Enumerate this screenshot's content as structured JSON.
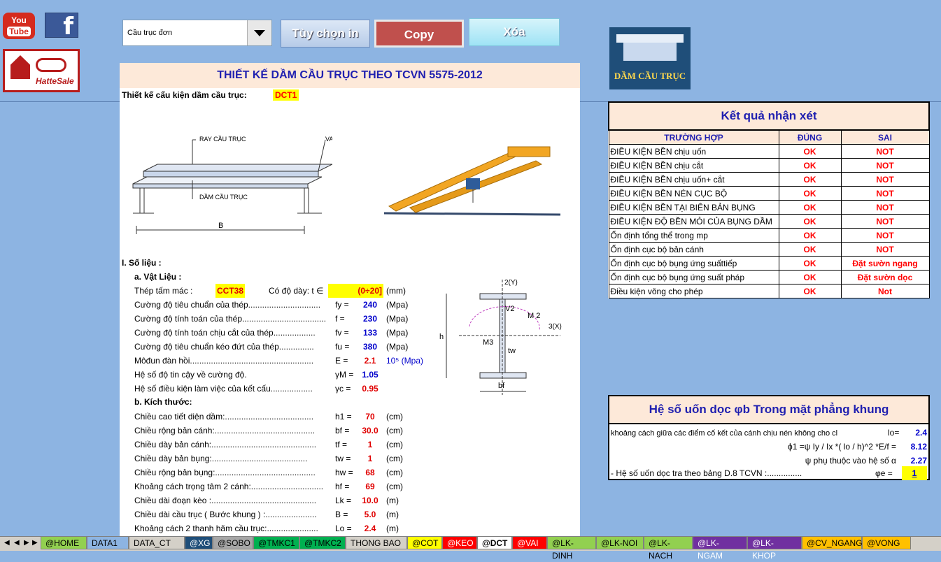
{
  "social": {
    "youtube_you": "You",
    "youtube_tube": "Tube",
    "facebook": "f",
    "hattesale": "HatteSale"
  },
  "toolbar": {
    "combo_value": "Cầu trục đơn",
    "btn_options": "Tùy chọn in",
    "btn_copy": "Copy",
    "btn_delete": "Xóa"
  },
  "logo_text": "DẦM CẦU TRỤC",
  "sheet": {
    "title": "THIẾT KẾ DẦM CẦU TRỤC THEO TCVN 5575-2012",
    "subtitle": "Thiết kế cấu kiện dầm cầu trục:",
    "code": "DCT1",
    "fig_labels": {
      "ray": "RAY CẦU TRỤC",
      "vai": "VAI CẦU TRỤC",
      "dam": "DẦM CẦU TRỤC",
      "b": "B"
    },
    "sec_title": "I.  Số liệu :",
    "mat_title": "a. Vật Liệu :",
    "steel_label": "Thép tấm mác :",
    "steel_value": "CCT38",
    "thick_label": "Có độ dày:  t ∈",
    "thick_value": "(0÷20]",
    "thick_unit": "(mm)",
    "section_labels": {
      "y": "2(Y)",
      "x": "3(X)",
      "v2": "V2",
      "m2": "M 2",
      "m3": "M3",
      "h": "h",
      "tw": "tw",
      "bf": "bf"
    },
    "materials": [
      {
        "label": "Cường độ tiêu chuẩn của thép...............................",
        "sym": "fy =",
        "value": "240",
        "unit": "(Mpa)"
      },
      {
        "label": "Cường độ tính toán của thép....................................",
        "sym": "f  =",
        "value": "230",
        "unit": "(Mpa)"
      },
      {
        "label": "Cường độ tính toán chịu cắt của thép..................",
        "sym": "fv =",
        "value": "133",
        "unit": "(Mpa)"
      },
      {
        "label": "Cường độ tiêu chuẩn kéo đứt của thép...............",
        "sym": "fu =",
        "value": "380",
        "unit": "(Mpa)"
      },
      {
        "label": "Môđun đàn hồi.....................................................",
        "sym": "E =",
        "value": "2.1",
        "unit": "10⁵ (Mpa)"
      },
      {
        "label": "Hệ số độ tin cậy về cường độ.",
        "sym": "γM =",
        "value": "1.05",
        "unit": ""
      },
      {
        "label": "Hệ số điều kiện làm việc của kết cấu..................",
        "sym": "γc =",
        "value": "0.95",
        "unit": ""
      }
    ],
    "dim_title": "b. Kích thước:",
    "dims": [
      {
        "label": "Chiều cao tiết diện dầm:......................................",
        "sym": "h1 =",
        "value": "70",
        "unit": "(cm)"
      },
      {
        "label": "Chiều rộng bản cánh:...........................................",
        "sym": "bf =",
        "value": "30.0",
        "unit": "(cm)"
      },
      {
        "label": "Chiều dày bản cánh:.............................................",
        "sym": "tf =",
        "value": "1",
        "unit": "(cm)"
      },
      {
        "label": "Chiều dày bản bụng:.........................................",
        "sym": "tw =",
        "value": "1",
        "unit": "(cm)"
      },
      {
        "label": "Chiều rộng bản bụng:...........................................",
        "sym": "hw =",
        "value": "68",
        "unit": "(cm)"
      },
      {
        "label": "Khoảng cách trọng tâm 2 cánh:...............................",
        "sym": "hf =",
        "value": "69",
        "unit": "(cm)"
      },
      {
        "label": "Chiều dài đoạn kèo :.............................................",
        "sym": "Lk =",
        "value": "10.0",
        "unit": "(m)"
      },
      {
        "label": "Chiều dài cầu trục ( Bước khung ) :......................",
        "sym": "B =",
        "value": "5.0",
        "unit": "(m)"
      },
      {
        "label": "Khoảng cách 2 thanh hãm cầu trục:......................",
        "sym": "Lo =",
        "value": "2.4",
        "unit": "(m)"
      }
    ]
  },
  "results": {
    "title": "Kết quả nhận xét",
    "headers": [
      "TRƯỜNG HỢP",
      "ĐÚNG",
      "SAI"
    ],
    "rows": [
      [
        "ĐIỀU KIỆN BỀN chịu uốn",
        "OK",
        "NOT"
      ],
      [
        "ĐIỀU KIỆN BỀN chịu cắt",
        "OK",
        "NOT"
      ],
      [
        "ĐIỀU KIỆN BỀN chịu uốn+ cắt",
        "OK",
        "NOT"
      ],
      [
        "ĐIỀU KIỆN BỀN NÉN CỤC BỘ",
        "OK",
        "NOT"
      ],
      [
        "ĐIỀU KIỆN BỀN TẠI BIÊN BẢN BỤNG",
        "OK",
        "NOT"
      ],
      [
        "ĐIỀU KIỆN ĐỘ BỀN MỎI CỦA BỤNG DẦM",
        "OK",
        "NOT"
      ],
      [
        "Ổn định tổng thể trong mp",
        "OK",
        "NOT"
      ],
      [
        "Ổn định cục bộ bản cánh",
        "OK",
        "NOT"
      ],
      [
        "Ổn định cục bộ bụng ứng suấttiếp",
        "OK",
        "Đặt sườn ngang"
      ],
      [
        "Ổn định cục bộ bụng ứng suất pháp",
        "OK",
        "Đặt sườn dọc"
      ],
      [
        "Điều kiện võng cho phép",
        "OK",
        "Not"
      ]
    ]
  },
  "phi": {
    "title": "Hệ số uốn dọc φb Trong mặt phẳng khung",
    "r1_label": "khoảng cách giữa các điểm cố kết của cánh chịu nén không cho cl",
    "r1_sym": "lo=",
    "r1_val": "2.4",
    "r2_label": "ϕ1 =ψ Iy / Ix *( lo / h)^2 *E/f =",
    "r2_val": "8.12",
    "r3_label": "ψ phụ thuộc vào hệ số α",
    "r3_val": "2.27",
    "r4_label": "- Hệ số uốn dọc tra theo bảng D.8 TCVN :...............",
    "r4_sym": "φe =",
    "r4_val": "1"
  },
  "tabs": [
    "@HOME",
    "DATA1",
    "DATA_CT",
    "@XG",
    "@SOBO",
    "@TMKC1",
    "@TMKC2",
    "THONG BAO",
    "@COT",
    "@KEO",
    "@DCT",
    "@VAI",
    "@LK-DINH",
    "@LK-NOI",
    "@LK-NACH",
    "@LK-NGAM",
    "@LK-KHOP",
    "@CV_NGANG",
    "@VONG"
  ],
  "active_tab": "@DCT",
  "colors": {
    "bg": "#8db4e2",
    "title_bg": "#fde9d9",
    "title_fg": "#1f1fb0",
    "ok": "#ff0000",
    "value_blue": "#0000cc"
  }
}
